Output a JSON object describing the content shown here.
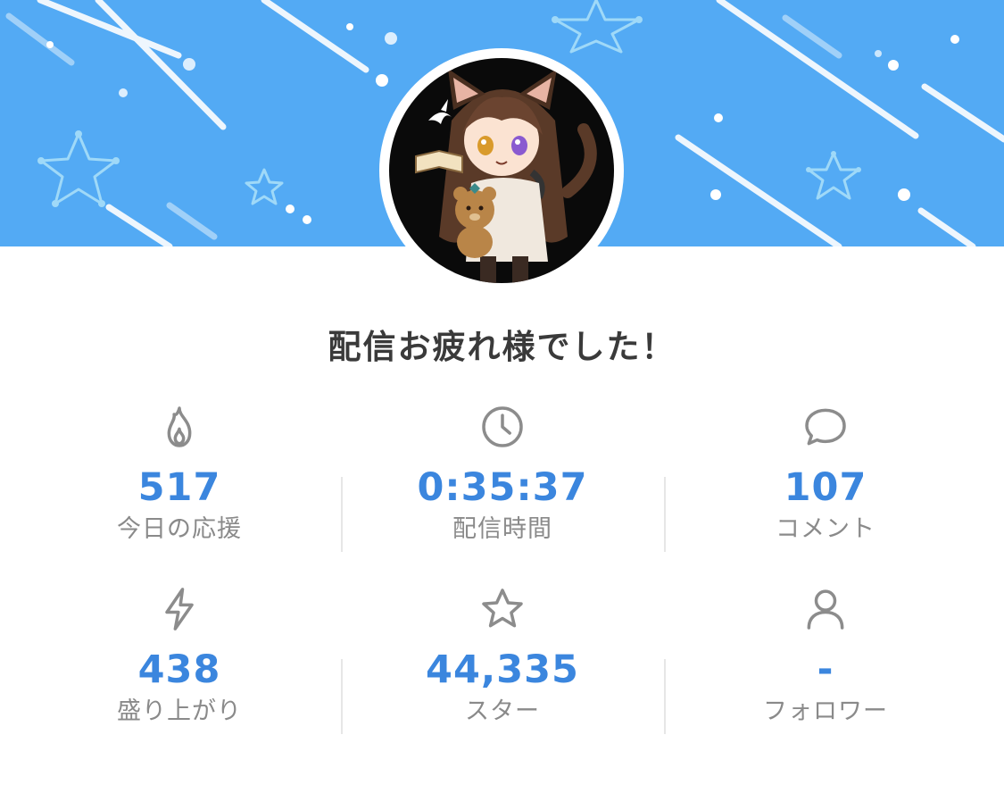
{
  "colors": {
    "banner": "#53aaf4",
    "value": "#3b86de",
    "label": "#8a8a8a",
    "title": "#3a3a3a",
    "icon": "#8c8c8c"
  },
  "title": "配信お疲れ様でした！",
  "stats": [
    {
      "icon": "flame-icon",
      "value": "517",
      "label": "今日の応援"
    },
    {
      "icon": "clock-icon",
      "value": "0:35:37",
      "label": "配信時間"
    },
    {
      "icon": "chat-bubble-icon",
      "value": "107",
      "label": "コメント"
    },
    {
      "icon": "lightning-icon",
      "value": "438",
      "label": "盛り上がり"
    },
    {
      "icon": "star-icon",
      "value": "44,335",
      "label": "スター"
    },
    {
      "icon": "person-icon",
      "value": "-",
      "label": "フォロワー"
    }
  ]
}
